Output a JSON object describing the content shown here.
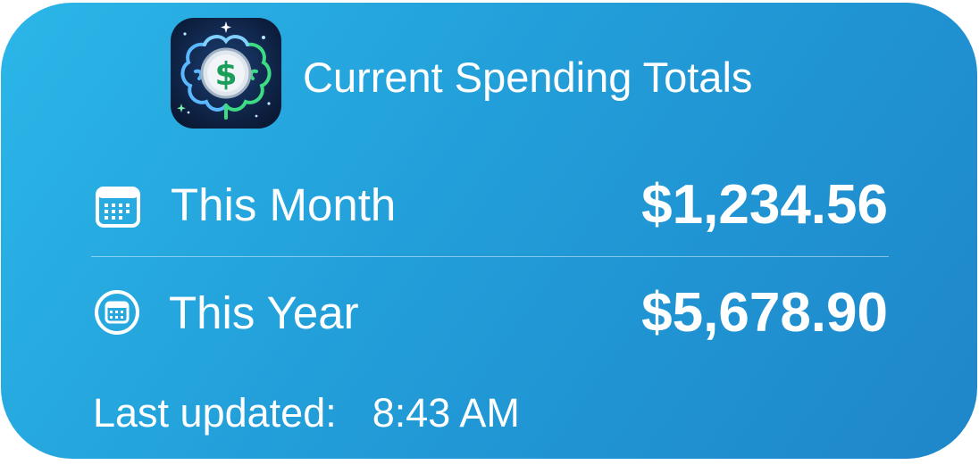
{
  "widget": {
    "title": "Current Spending Totals",
    "app_icon": "brain-dollar-app-icon",
    "rows": [
      {
        "icon": "calendar-icon",
        "label": "This Month",
        "value": "$1,234.56"
      },
      {
        "icon": "calendar-circle-icon",
        "label": "This Year",
        "value": "$5,678.90"
      }
    ],
    "updated_label": "Last updated:",
    "updated_time": "8:43 AM"
  },
  "colors": {
    "background_start": "#2bb6e8",
    "background_end": "#1e86c9",
    "text": "#ffffff",
    "icon_green": "#3ddc84",
    "icon_blue": "#5ab8ff"
  }
}
